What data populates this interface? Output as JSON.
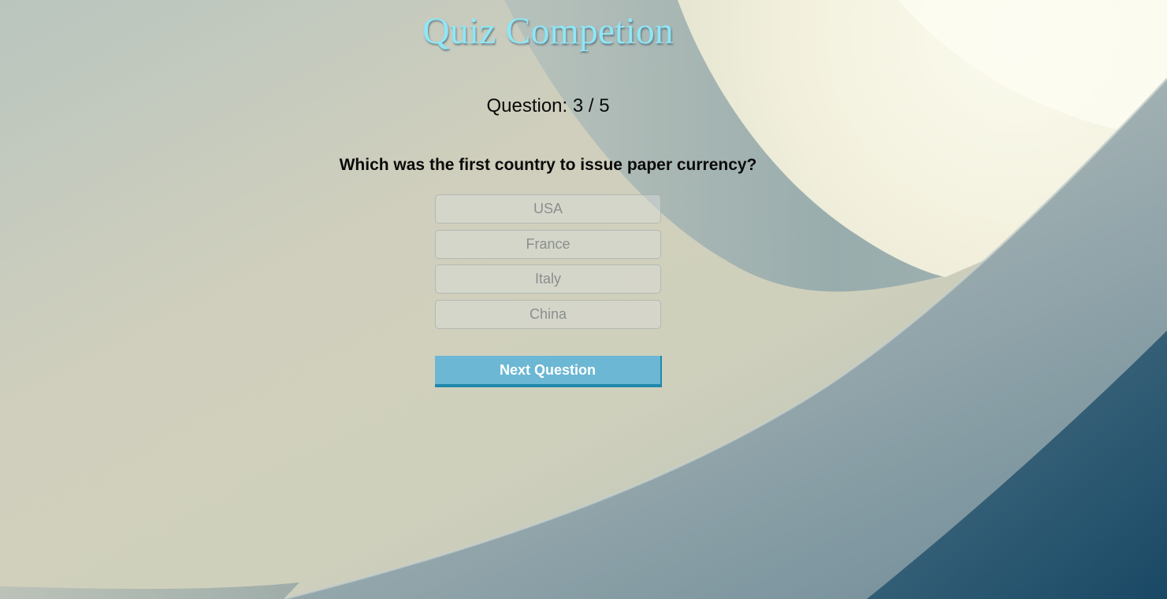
{
  "header": {
    "title": "Quiz Competion"
  },
  "quiz": {
    "counter": "Question: 3 / 5",
    "question": "Which was the first country to issue paper currency?",
    "answers": [
      "USA",
      "France",
      "Italy",
      "China"
    ],
    "next_label": "Next Question"
  },
  "colors": {
    "title": "#8fe6f6",
    "next_button": "#6bb7d4",
    "next_button_border": "#1f88ab",
    "answer_text": "#8a8f8f"
  }
}
